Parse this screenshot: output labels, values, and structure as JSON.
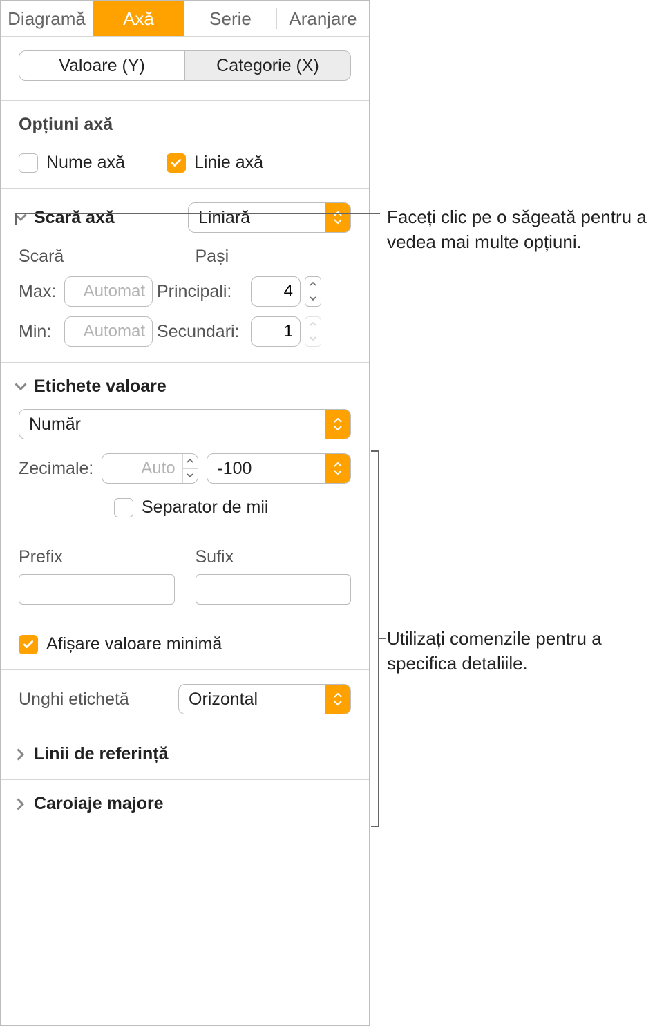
{
  "topnav": {
    "chart": "Diagramă",
    "axis": "Axă",
    "series": "Serie",
    "arrange": "Aranjare"
  },
  "subtabs": {
    "value_y": "Valoare (Y)",
    "category_x": "Categorie (X)"
  },
  "axis_options": {
    "title": "Opțiuni axă",
    "axis_name": "Nume axă",
    "axis_line": "Linie axă"
  },
  "axis_scale": {
    "title": "Scară axă",
    "type_value": "Liniară",
    "scale_label": "Scară",
    "steps_label": "Pași",
    "max_label": "Max:",
    "min_label": "Min:",
    "auto_placeholder": "Automat",
    "major_label": "Principali:",
    "major_value": "4",
    "minor_label": "Secundari:",
    "minor_value": "1"
  },
  "value_labels": {
    "title": "Etichete valoare",
    "format_value": "Număr",
    "decimals_label": "Zecimale:",
    "decimals_placeholder": "Auto",
    "neg_format_value": "-100",
    "thousands_sep": "Separator de mii",
    "prefix_label": "Prefix",
    "suffix_label": "Sufix",
    "show_min": "Afișare valoare minimă",
    "label_angle": "Unghi etichetă",
    "angle_value": "Orizontal"
  },
  "ref_lines": "Linii de referință",
  "major_grid": "Caroiaje majore",
  "callouts": {
    "c1": "Faceți clic pe o săgeată pentru a vedea mai multe opțiuni.",
    "c2": "Utilizați comenzile pentru a specifica detaliile."
  }
}
